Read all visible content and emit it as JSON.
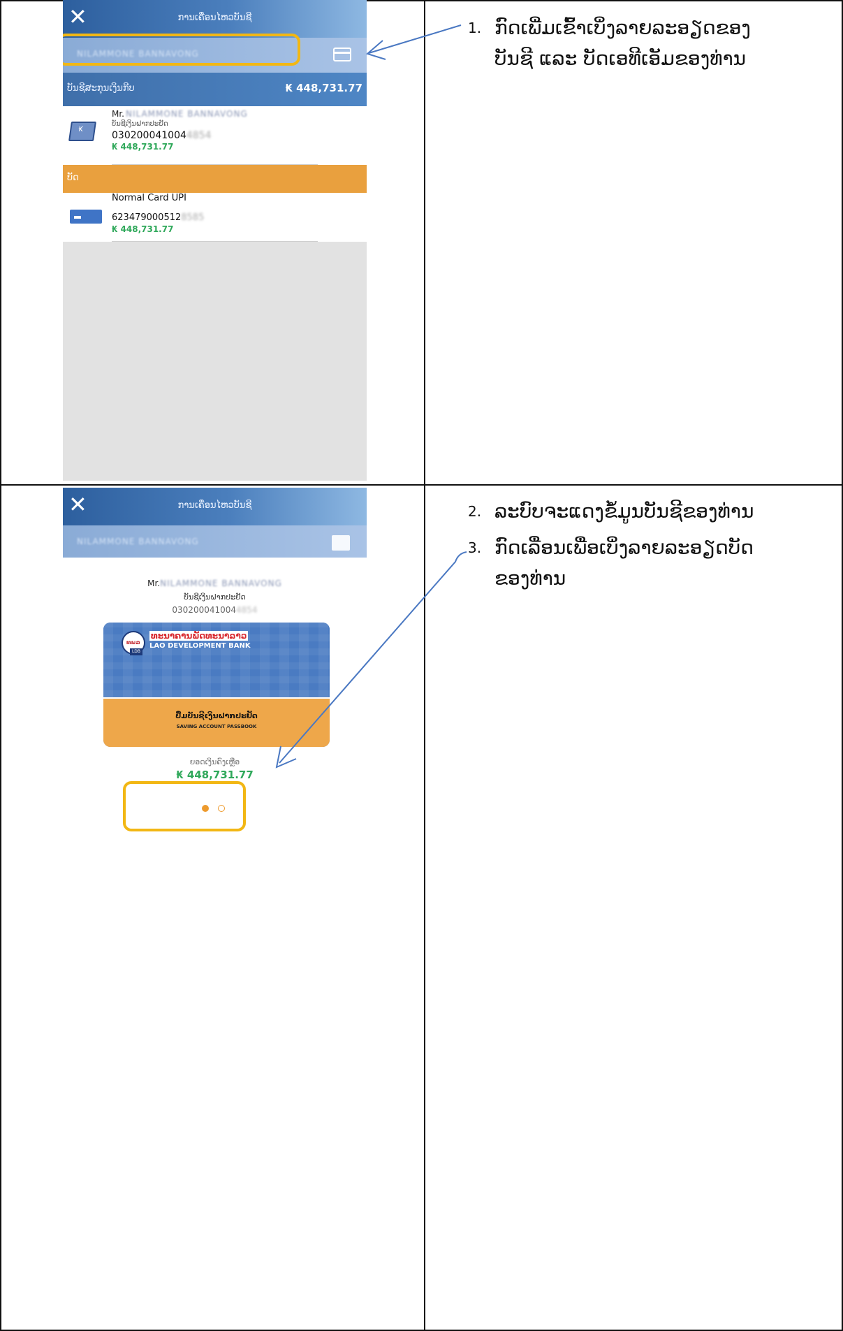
{
  "header": {
    "title": "ການເຄື່ອນໄຫວບັນຊີ",
    "close_symbol": "✕"
  },
  "screen1": {
    "account_bar_name": "NILAMMONE BANNAVONG",
    "section_account_label": "ບັນຊີສະກຸນເງິນກີບ",
    "section_account_amount": "₭ 448,731.77",
    "account": {
      "title_prefix": "Mr.",
      "name": "NILAMMONE BANNAVONG",
      "type": "ບັນຊີເງິນຝາກປະຢັດ",
      "number_visible": "030200041004",
      "number_hidden": "4854",
      "amount": "₭ 448,731.77",
      "icon": "passbook-icon",
      "icon_symbol": "₭"
    },
    "section_card_label": "ບັດ",
    "card": {
      "name": "Normal Card UPI",
      "number_visible": "623479000512",
      "number_hidden": "8585",
      "amount": "₭ 448,731.77",
      "icon": "card-icon"
    }
  },
  "screen2": {
    "account_bar_name": "NILAMMONE BANNAVONG",
    "title_prefix": "Mr.",
    "name": "NILAMMONE BANNAVONG",
    "type": "ບັນຊີເງິນຝາກປະຢັດ",
    "number_visible": "030200041004",
    "number_hidden": "4854",
    "bank_card": {
      "logo_text": "ທພລ",
      "logo_abbrev": "LDB",
      "bank_name_lao": "ທະນາຄານພັດທະນາລາວ",
      "bank_name_en": "LAO DEVELOPMENT BANK",
      "passbook_lao": "ປື້ມບັນຊີເງິນຝາກປະຢັດ",
      "passbook_en": "SAVING ACCOUNT PASSBOOK"
    },
    "balance_label": "ຍອດເງິນຄົງເຫຼືອ",
    "balance": "₭ 448,731.77",
    "pager": {
      "current": 1,
      "total": 2
    }
  },
  "instructions": [
    {
      "num": "1.",
      "text": "ກົດເພີ່ມເຂົ້າເບິ່ງລາຍລະອຽດຂອງ ບັນຊີ ແລະ ບັດເອທີເອັມຂອງທ່ານ"
    },
    {
      "num": "2.",
      "text": "ລະບົບຈະແດງຂໍ້ມູນບັນຊີຂອງທ່ານ"
    },
    {
      "num": "3.",
      "text": "ກົດເລື່ອນເພື່ອເບິ່ງລາຍລະອຽດບັດ ຂອງທ່ານ"
    }
  ],
  "colors": {
    "highlight": "#f2b714",
    "arrow": "#4a78c2",
    "accent_orange": "#e9a03e",
    "amount_green": "#2fa85a",
    "header_blue": "#2d5f9e"
  }
}
